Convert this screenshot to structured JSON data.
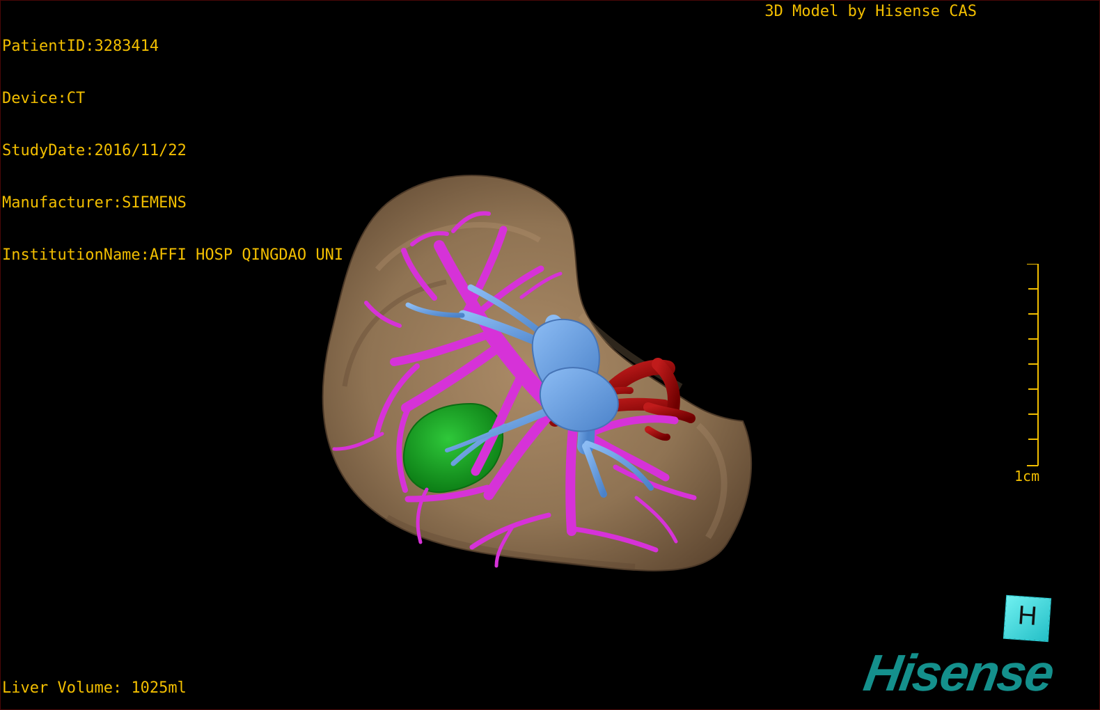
{
  "metadata": {
    "patient_id": "PatientID:3283414",
    "device": "Device:CT",
    "study_date": "StudyDate:2016/11/22",
    "manufacturer": "Manufacturer:SIEMENS",
    "institution_name": "InstitutionName:AFFI HOSP QINGDAO UNI"
  },
  "header": {
    "model_credit": "3D Model by Hisense CAS"
  },
  "footer": {
    "liver_volume": "Liver Volume: 1025ml"
  },
  "scale_bar": {
    "label": "1cm"
  },
  "orientation_marker": {
    "label": "H"
  },
  "brand": {
    "logo_text": "Hisense"
  },
  "colors": {
    "overlay_text": "#f3bf00",
    "liver_surface": "#7d6548",
    "portal_vessels": "#d833d6",
    "hepatic_veins": "#6ea1e0",
    "tumor": "#1d9d20",
    "artery": "#a00f0f",
    "orientation_cube": "#43d8df",
    "brand_logo": "#14908c"
  }
}
